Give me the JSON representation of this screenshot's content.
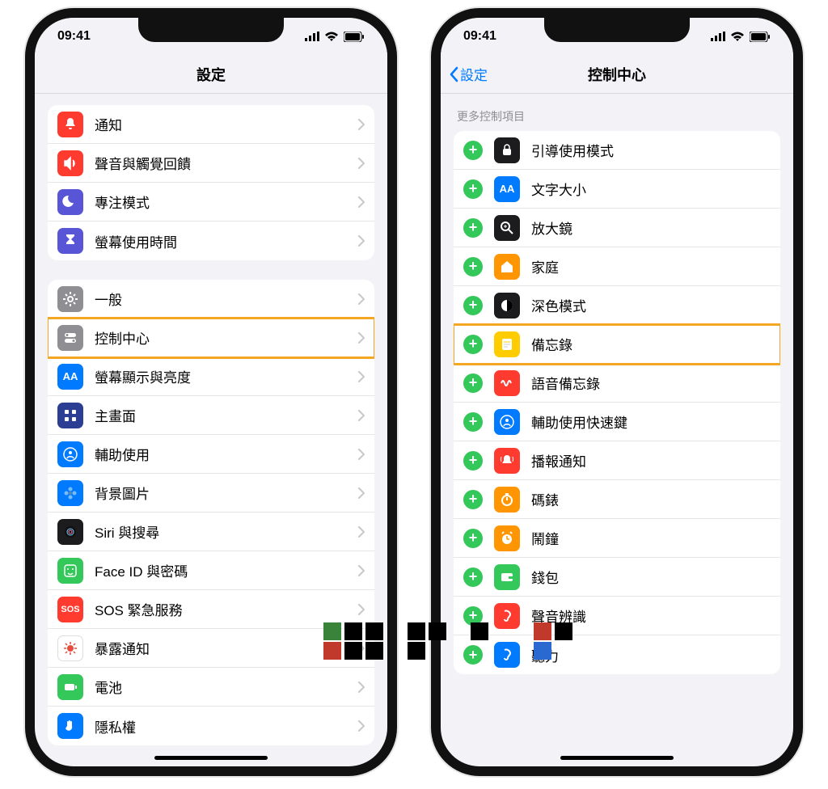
{
  "status": {
    "time": "09:41"
  },
  "left": {
    "title": "設定",
    "group1": [
      {
        "id": "notifications",
        "label": "通知",
        "bg": "ic-red",
        "glyph": "bell"
      },
      {
        "id": "sounds",
        "label": "聲音與觸覺回饋",
        "bg": "ic-red",
        "glyph": "speaker"
      },
      {
        "id": "focus",
        "label": "專注模式",
        "bg": "ic-purple",
        "glyph": "moon"
      },
      {
        "id": "screentime",
        "label": "螢幕使用時間",
        "bg": "ic-purple",
        "glyph": "hourglass"
      }
    ],
    "group2": [
      {
        "id": "general",
        "label": "一般",
        "bg": "ic-gray",
        "glyph": "gear"
      },
      {
        "id": "control-center",
        "label": "控制中心",
        "bg": "ic-gray",
        "glyph": "toggles",
        "hl": true
      },
      {
        "id": "display",
        "label": "螢幕顯示與亮度",
        "bg": "ic-blue",
        "glyph": "AA"
      },
      {
        "id": "home",
        "label": "主畫面",
        "bg": "ic-darkblue",
        "glyph": "grid"
      },
      {
        "id": "accessibility",
        "label": "輔助使用",
        "bg": "ic-blue",
        "glyph": "person"
      },
      {
        "id": "wallpaper",
        "label": "背景圖片",
        "bg": "ic-blue",
        "glyph": "flower"
      },
      {
        "id": "siri",
        "label": "Siri 與搜尋",
        "bg": "ic-black",
        "glyph": "siri"
      },
      {
        "id": "faceid",
        "label": "Face ID 與密碼",
        "bg": "ic-green",
        "glyph": "face"
      },
      {
        "id": "sos",
        "label": "SOS 緊急服務",
        "bg": "ic-red",
        "glyph": "SOS"
      },
      {
        "id": "exposure",
        "label": "暴露通知",
        "bg": "ic-white",
        "glyph": "virus"
      },
      {
        "id": "battery",
        "label": "電池",
        "bg": "ic-green",
        "glyph": "battery"
      },
      {
        "id": "privacy",
        "label": "隱私權",
        "bg": "ic-blue",
        "glyph": "hand"
      }
    ]
  },
  "right": {
    "back": "設定",
    "title": "控制中心",
    "section": "更多控制項目",
    "items": [
      {
        "id": "guided",
        "label": "引導使用模式",
        "bg": "ic-black",
        "glyph": "lock"
      },
      {
        "id": "textsize",
        "label": "文字大小",
        "bg": "ic-blue",
        "glyph": "AA"
      },
      {
        "id": "magnifier",
        "label": "放大鏡",
        "bg": "ic-black",
        "glyph": "mag"
      },
      {
        "id": "home2",
        "label": "家庭",
        "bg": "ic-orange",
        "glyph": "house"
      },
      {
        "id": "dark",
        "label": "深色模式",
        "bg": "ic-black",
        "glyph": "half"
      },
      {
        "id": "notes",
        "label": "備忘錄",
        "bg": "ic-yellow",
        "glyph": "note",
        "hl": true
      },
      {
        "id": "voicememo",
        "label": "語音備忘錄",
        "bg": "ic-red",
        "glyph": "wave"
      },
      {
        "id": "shortcuts",
        "label": "輔助使用快速鍵",
        "bg": "ic-blue",
        "glyph": "person"
      },
      {
        "id": "announce",
        "label": "播報通知",
        "bg": "ic-red",
        "glyph": "bellring"
      },
      {
        "id": "stopwatch",
        "label": "碼錶",
        "bg": "ic-orange",
        "glyph": "stopwatch"
      },
      {
        "id": "alarm",
        "label": "鬧鐘",
        "bg": "ic-orange",
        "glyph": "alarm"
      },
      {
        "id": "wallet",
        "label": "錢包",
        "bg": "ic-green",
        "glyph": "wallet"
      },
      {
        "id": "sound-rec",
        "label": "聲音辨識",
        "bg": "ic-red",
        "glyph": "ear"
      },
      {
        "id": "hearing",
        "label": "聽力",
        "bg": "ic-blue",
        "glyph": "ear2"
      }
    ]
  }
}
